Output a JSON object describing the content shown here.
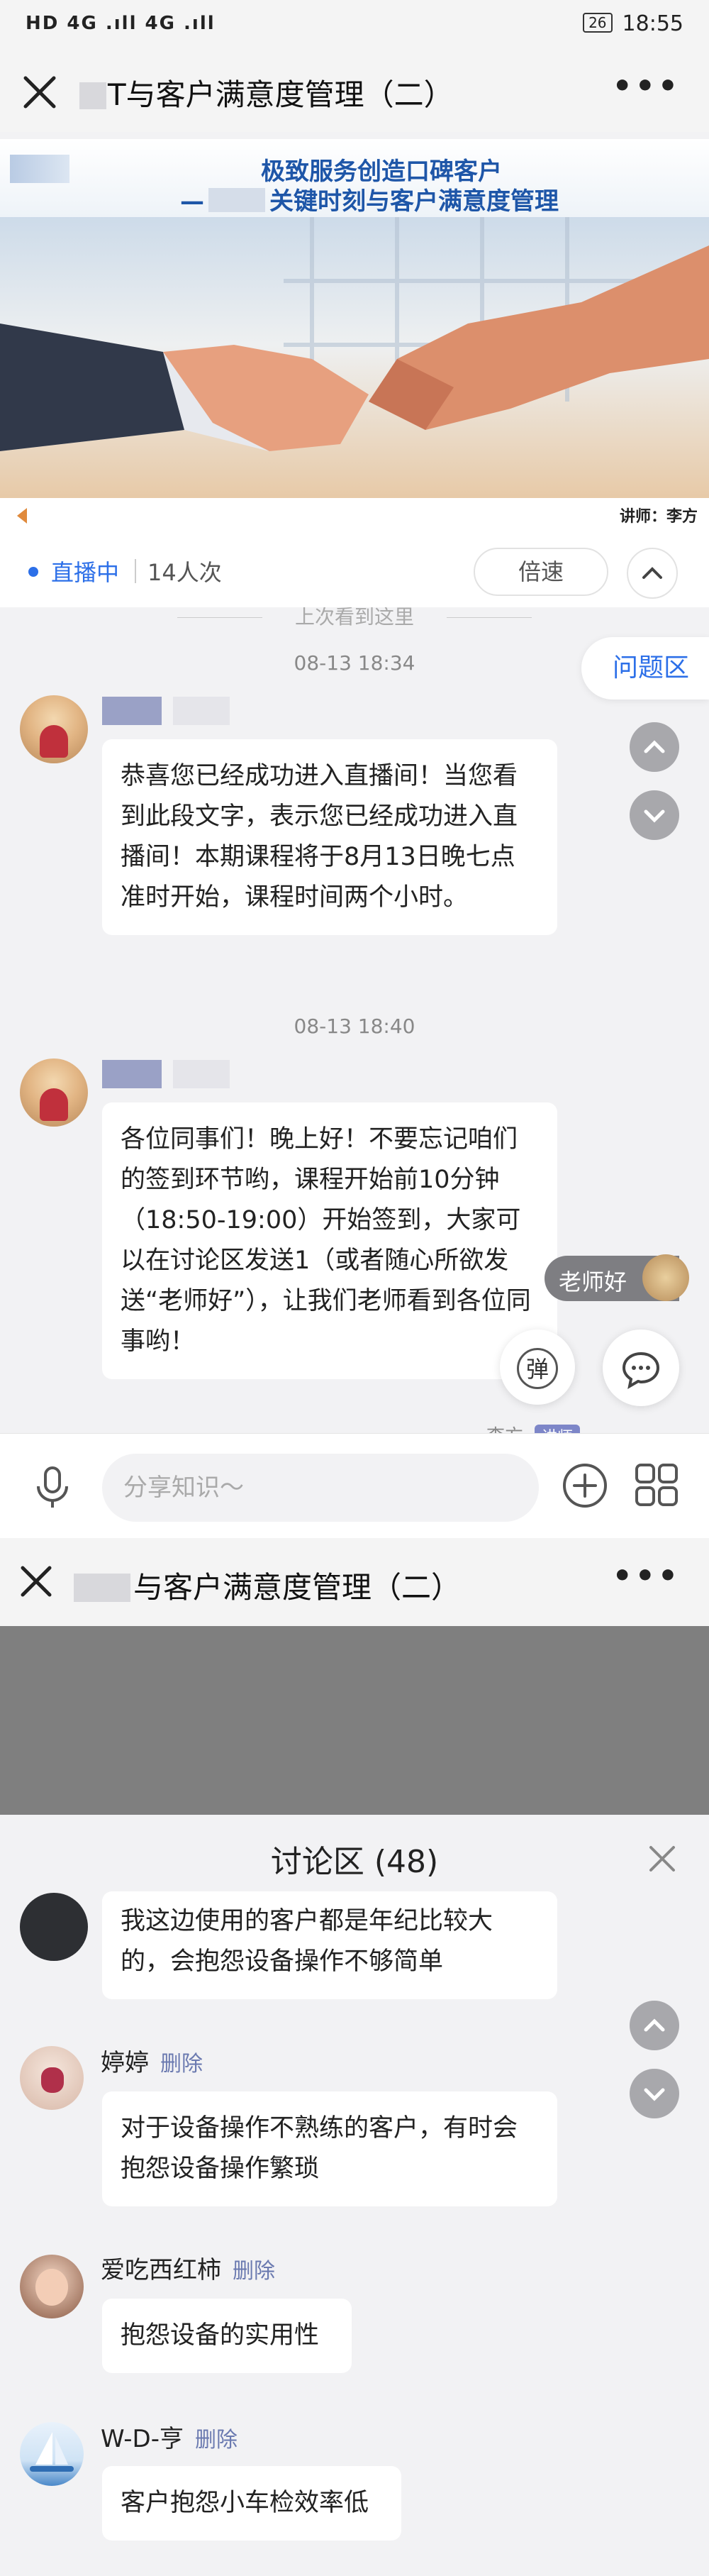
{
  "status_bar": {
    "left_text": "HD 4G .ıll 4G .ıll",
    "right_text": "18:55",
    "battery": "26"
  },
  "header": {
    "title": "与客户满意度管理（二）",
    "title_prefix": "T"
  },
  "banner": {
    "line1": "极致服务创造口碑客户",
    "line2_dash": "—",
    "line2": "关键时刻与客户满意度管理",
    "speaker_label": "讲师：李方"
  },
  "live": {
    "status": "直播中",
    "views": "14人次",
    "speed_button": "倍速"
  },
  "chat": {
    "last_seen": "上次看到这里",
    "question_zone": "问题区",
    "messages": [
      {
        "time": "08-13 18:34",
        "text": "恭喜您已经成功进入直播间！当您看到此段文字，表示您已经成功进入直播间！本期课程将于8月13日晚七点准时开始，课程时间两个小时。"
      },
      {
        "time": "08-13 18:40",
        "text": "各位同事们！晚上好！不要忘记咱们的签到环节哟，课程开始前10分钟（18:50-19:00）开始签到，大家可以在讨论区发送1（或者随心所欲发送“老师好”），让我们老师看到各位同事哟！"
      }
    ],
    "floating_tag": "老师好",
    "danmu_button": "弹",
    "peek_name": "李方",
    "peek_tag": "讲师"
  },
  "input": {
    "placeholder": "分享知识～"
  },
  "second_header": {
    "title": "与客户满意度管理（二）"
  },
  "discussion": {
    "title": "讨论区 (48)",
    "delete_label": "删除",
    "entries": [
      {
        "name": "",
        "text": "我这边使用的客户都是年纪比较大的，会抱怨设备操作不够简单"
      },
      {
        "name": "婷婷",
        "text": "对于设备操作不熟练的客户，有时会抱怨设备操作繁琐"
      },
      {
        "name": "爱吃西红柿",
        "text": "抱怨设备的实用性"
      },
      {
        "name": "W-D-亨",
        "text": "客户抱怨小车检效率低"
      }
    ]
  },
  "colors": {
    "accent_blue": "#2c6fe8",
    "banner_blue": "#1e56a8",
    "bubble_bg": "#ffffff",
    "page_bg": "#f2f2f4"
  }
}
